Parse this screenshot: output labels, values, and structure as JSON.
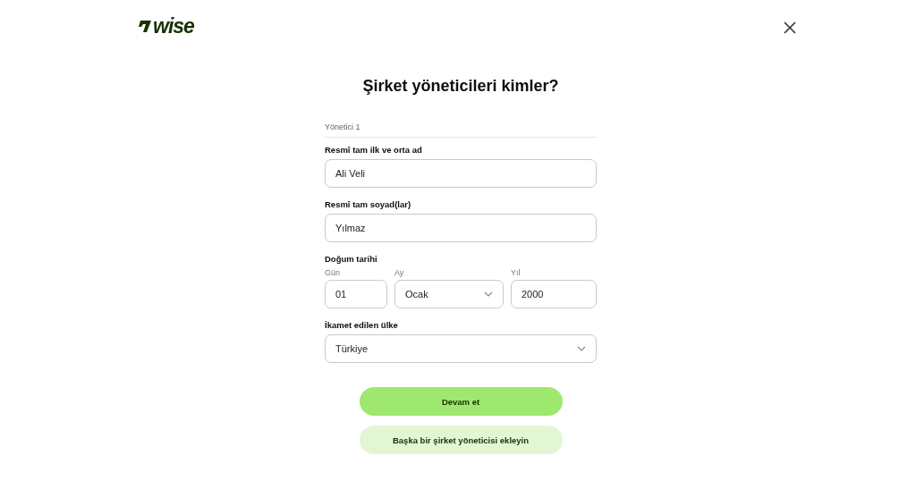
{
  "header": {
    "logo_text": "wise"
  },
  "title": "Şirket yöneticileri kimler?",
  "section": "Yönetici 1",
  "fields": [
    {
      "kind": "text",
      "label": "Resmî tam ilk ve orta ad",
      "value": "Ali Veli"
    },
    {
      "kind": "text",
      "label": "Resmî tam soyad(lar)",
      "value": "Yılmaz"
    },
    {
      "kind": "date",
      "label": "Doğum tarihi",
      "parts": [
        {
          "kind": "text",
          "label": "Gün",
          "value": "01"
        },
        {
          "kind": "select",
          "label": "Ay",
          "value": "Ocak"
        },
        {
          "kind": "text",
          "label": "Yıl",
          "value": "2000"
        }
      ]
    },
    {
      "kind": "select",
      "label": "İkamet edilen ülke",
      "value": "Türkiye"
    }
  ],
  "buttons": [
    {
      "kind": "primary",
      "label": "Devam et"
    },
    {
      "kind": "secondary",
      "label": "Başka bir şirket yöneticisi ekleyin"
    }
  ]
}
